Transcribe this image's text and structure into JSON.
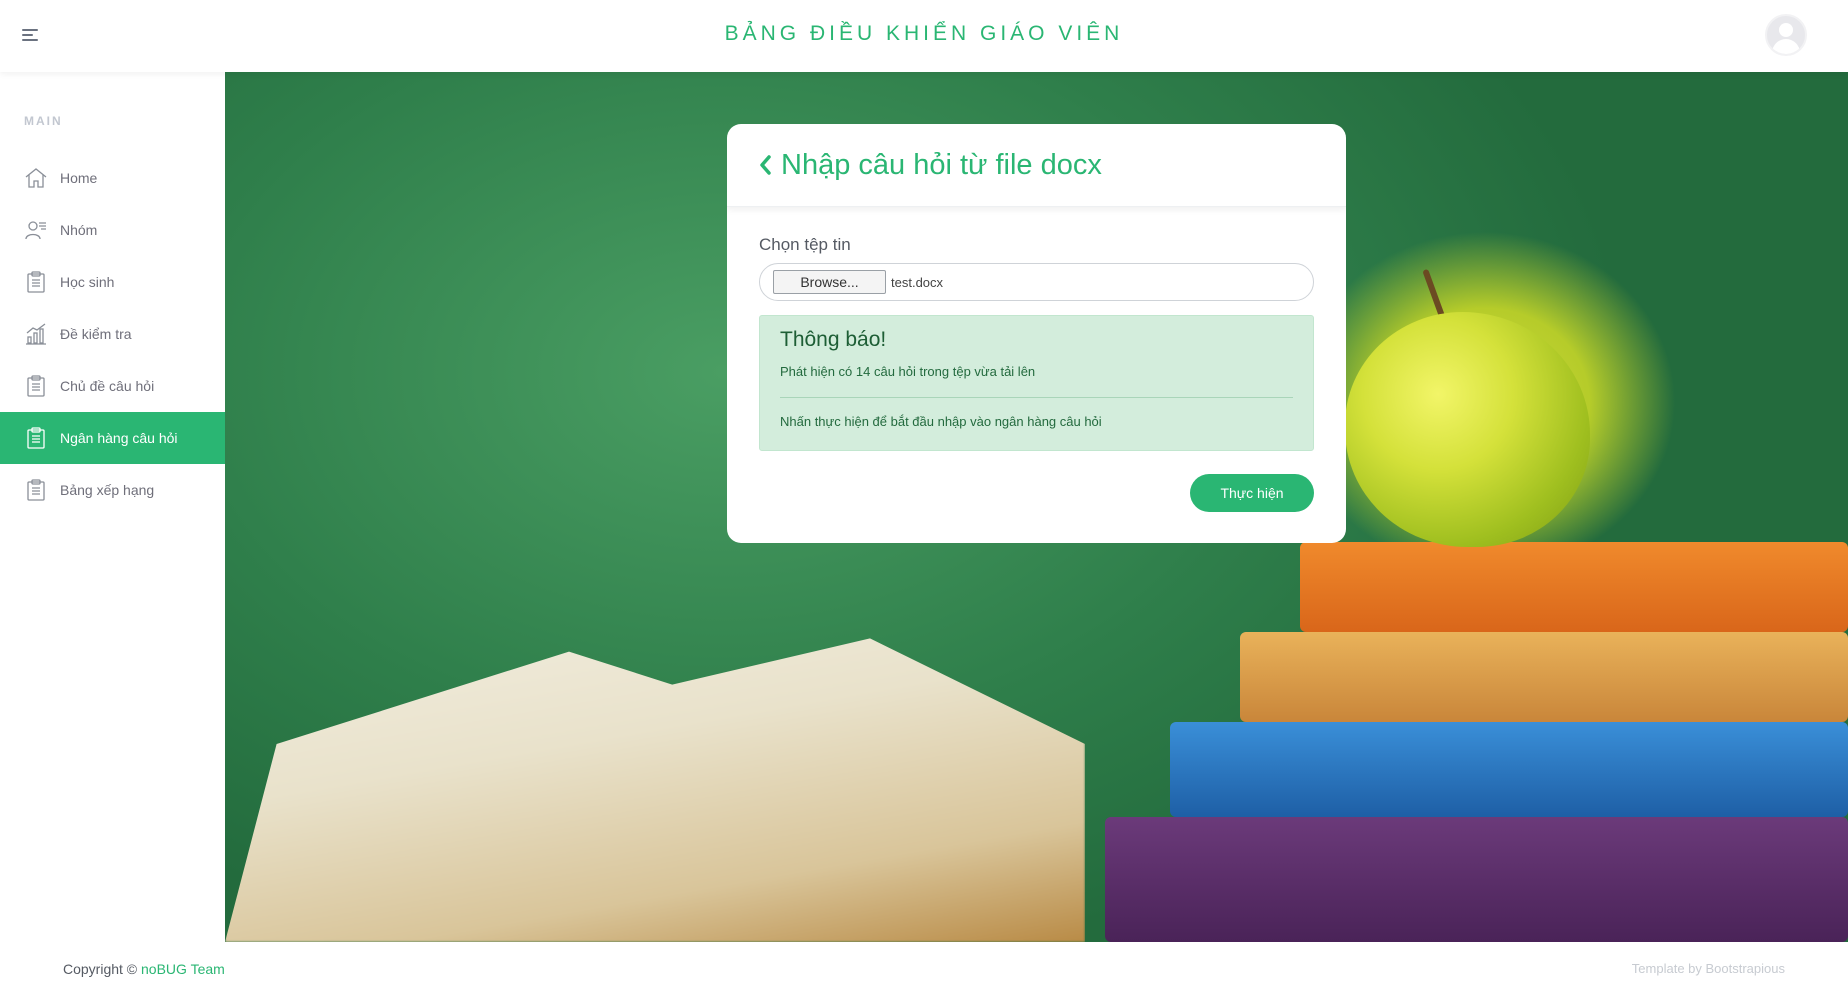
{
  "header": {
    "title": "BẢNG ĐIỀU KHIỂN GIÁO VIÊN"
  },
  "sidebar": {
    "heading": "MAIN",
    "items": [
      {
        "label": "Home",
        "icon": "home-icon"
      },
      {
        "label": "Nhóm",
        "icon": "group-icon"
      },
      {
        "label": "Học sinh",
        "icon": "clipboard-icon"
      },
      {
        "label": "Đề kiểm tra",
        "icon": "bar-chart-icon"
      },
      {
        "label": "Chủ đề câu hỏi",
        "icon": "clipboard-icon"
      },
      {
        "label": "Ngân hàng câu hỏi",
        "icon": "clipboard-icon",
        "active": true
      },
      {
        "label": "Bảng xếp hạng",
        "icon": "clipboard-icon"
      }
    ]
  },
  "card": {
    "title": "Nhập câu hỏi từ file docx",
    "file_label": "Chọn tệp tin",
    "browse_label": "Browse...",
    "file_name": "test.docx",
    "alert": {
      "title": "Thông báo!",
      "line1": "Phát hiện có 14 câu hỏi trong tệp vừa tải lên",
      "line2": "Nhấn thực hiện để bắt đầu nhập vào ngân hàng câu hỏi"
    },
    "submit_label": "Thực hiện"
  },
  "footer": {
    "copyright_prefix": "Copyright © ",
    "team": "noBUG Team",
    "credit": "Template by Bootstrapious"
  },
  "colors": {
    "accent": "#2ab673",
    "alert_bg": "#d3eddc"
  }
}
